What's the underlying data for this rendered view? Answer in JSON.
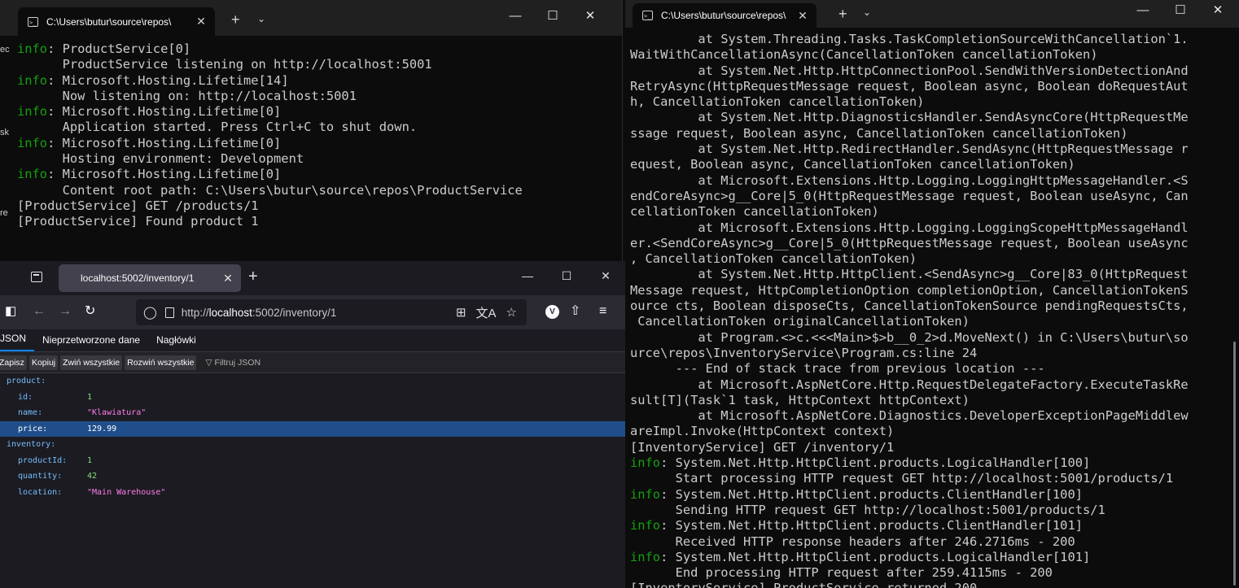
{
  "left_terminal": {
    "tab_title": "C:\\Users\\butur\\source\\repos\\",
    "lines": [
      {
        "prefix": "info",
        "text": ": ProductService[0]"
      },
      {
        "prefix": "",
        "text": "      ProductService listening on http://localhost:5001"
      },
      {
        "prefix": "info",
        "text": ": Microsoft.Hosting.Lifetime[14]"
      },
      {
        "prefix": "",
        "text": "      Now listening on: http://localhost:5001"
      },
      {
        "prefix": "info",
        "text": ": Microsoft.Hosting.Lifetime[0]"
      },
      {
        "prefix": "",
        "text": "      Application started. Press Ctrl+C to shut down."
      },
      {
        "prefix": "info",
        "text": ": Microsoft.Hosting.Lifetime[0]"
      },
      {
        "prefix": "",
        "text": "      Hosting environment: Development"
      },
      {
        "prefix": "info",
        "text": ": Microsoft.Hosting.Lifetime[0]"
      },
      {
        "prefix": "",
        "text": "      Content root path: C:\\Users\\butur\\source\\repos\\ProductService"
      },
      {
        "prefix": "",
        "text": "[ProductService] GET /products/1"
      },
      {
        "prefix": "",
        "text": "[ProductService] Found product 1"
      }
    ]
  },
  "right_terminal": {
    "tab_title": "C:\\Users\\butur\\source\\repos\\",
    "lines": [
      {
        "prefix": "",
        "text": "         at System.Threading.Tasks.TaskCompletionSourceWithCancellation`1."
      },
      {
        "prefix": "",
        "text": "WaitWithCancellationAsync(CancellationToken cancellationToken)"
      },
      {
        "prefix": "",
        "text": "         at System.Net.Http.HttpConnectionPool.SendWithVersionDetectionAnd"
      },
      {
        "prefix": "",
        "text": "RetryAsync(HttpRequestMessage request, Boolean async, Boolean doRequestAut"
      },
      {
        "prefix": "",
        "text": "h, CancellationToken cancellationToken)"
      },
      {
        "prefix": "",
        "text": "         at System.Net.Http.DiagnosticsHandler.SendAsyncCore(HttpRequestMe"
      },
      {
        "prefix": "",
        "text": "ssage request, Boolean async, CancellationToken cancellationToken)"
      },
      {
        "prefix": "",
        "text": "         at System.Net.Http.RedirectHandler.SendAsync(HttpRequestMessage r"
      },
      {
        "prefix": "",
        "text": "equest, Boolean async, CancellationToken cancellationToken)"
      },
      {
        "prefix": "",
        "text": "         at Microsoft.Extensions.Http.Logging.LoggingHttpMessageHandler.<S"
      },
      {
        "prefix": "",
        "text": "endCoreAsync>g__Core|5_0(HttpRequestMessage request, Boolean useAsync, Can"
      },
      {
        "prefix": "",
        "text": "cellationToken cancellationToken)"
      },
      {
        "prefix": "",
        "text": "         at Microsoft.Extensions.Http.Logging.LoggingScopeHttpMessageHandl"
      },
      {
        "prefix": "",
        "text": "er.<SendCoreAsync>g__Core|5_0(HttpRequestMessage request, Boolean useAsync"
      },
      {
        "prefix": "",
        "text": ", CancellationToken cancellationToken)"
      },
      {
        "prefix": "",
        "text": "         at System.Net.Http.HttpClient.<SendAsync>g__Core|83_0(HttpRequest"
      },
      {
        "prefix": "",
        "text": "Message request, HttpCompletionOption completionOption, CancellationTokenS"
      },
      {
        "prefix": "",
        "text": "ource cts, Boolean disposeCts, CancellationTokenSource pendingRequestsCts,"
      },
      {
        "prefix": "",
        "text": " CancellationToken originalCancellationToken)"
      },
      {
        "prefix": "",
        "text": "         at Program.<>c.<<<Main>$>b__0_2>d.MoveNext() in C:\\Users\\butur\\so"
      },
      {
        "prefix": "",
        "text": "urce\\repos\\InventoryService\\Program.cs:line 24"
      },
      {
        "prefix": "",
        "text": "      --- End of stack trace from previous location ---"
      },
      {
        "prefix": "",
        "text": "         at Microsoft.AspNetCore.Http.RequestDelegateFactory.ExecuteTaskRe"
      },
      {
        "prefix": "",
        "text": "sult[T](Task`1 task, HttpContext httpContext)"
      },
      {
        "prefix": "",
        "text": "         at Microsoft.AspNetCore.Diagnostics.DeveloperExceptionPageMiddlew"
      },
      {
        "prefix": "",
        "text": "areImpl.Invoke(HttpContext context)"
      },
      {
        "prefix": "",
        "text": "[InventoryService] GET /inventory/1"
      },
      {
        "prefix": "info",
        "text": ": System.Net.Http.HttpClient.products.LogicalHandler[100]"
      },
      {
        "prefix": "",
        "text": "      Start processing HTTP request GET http://localhost:5001/products/1"
      },
      {
        "prefix": "info",
        "text": ": System.Net.Http.HttpClient.products.ClientHandler[100]"
      },
      {
        "prefix": "",
        "text": "      Sending HTTP request GET http://localhost:5001/products/1"
      },
      {
        "prefix": "info",
        "text": ": System.Net.Http.HttpClient.products.ClientHandler[101]"
      },
      {
        "prefix": "",
        "text": "      Received HTTP response headers after 246.2716ms - 200"
      },
      {
        "prefix": "info",
        "text": ": System.Net.Http.HttpClient.products.LogicalHandler[101]"
      },
      {
        "prefix": "",
        "text": "      End processing HTTP request after 259.4115ms - 200"
      },
      {
        "prefix": "",
        "text": "[InventoryService] ProductService returned 200"
      }
    ]
  },
  "browser": {
    "tab_title": "localhost:5002/inventory/1",
    "url_prefix": "http://",
    "url_host": "localhost",
    "url_rest": ":5002/inventory/1",
    "avatar_letter": "V",
    "viewer_tabs": [
      "JSON",
      "Nieprzetworzone dane",
      "Nagłówki"
    ],
    "toolbar": {
      "save": "Zapisz",
      "copy": "Kopiuj",
      "collapse": "Zwiń wszystkie",
      "expand": "Rozwiń wszystkie",
      "filter": "Filtruj JSON"
    },
    "tree": [
      {
        "key": "product:",
        "value": "",
        "type": "obj",
        "indent": 0
      },
      {
        "key": "id:",
        "value": "1",
        "type": "num",
        "indent": 1
      },
      {
        "key": "name:",
        "value": "\"Klawiatura\"",
        "type": "str",
        "indent": 1
      },
      {
        "key": "price:",
        "value": "129.99",
        "type": "num",
        "indent": 1,
        "selected": true
      },
      {
        "key": "inventory:",
        "value": "",
        "type": "obj",
        "indent": 0
      },
      {
        "key": "productId:",
        "value": "1",
        "type": "num",
        "indent": 1
      },
      {
        "key": "quantity:",
        "value": "42",
        "type": "num",
        "indent": 1
      },
      {
        "key": "location:",
        "value": "\"Main Warehouse\"",
        "type": "str",
        "indent": 1
      }
    ]
  },
  "desktop_edge_fragments": [
    "ec",
    "sk",
    "re"
  ],
  "colors": {
    "info_green": "#13a10e",
    "terminal_text": "#cccccc",
    "json_key": "#75bfff",
    "json_number": "#86de74",
    "json_string": "#ff7de9",
    "selection": "#204e8a"
  }
}
